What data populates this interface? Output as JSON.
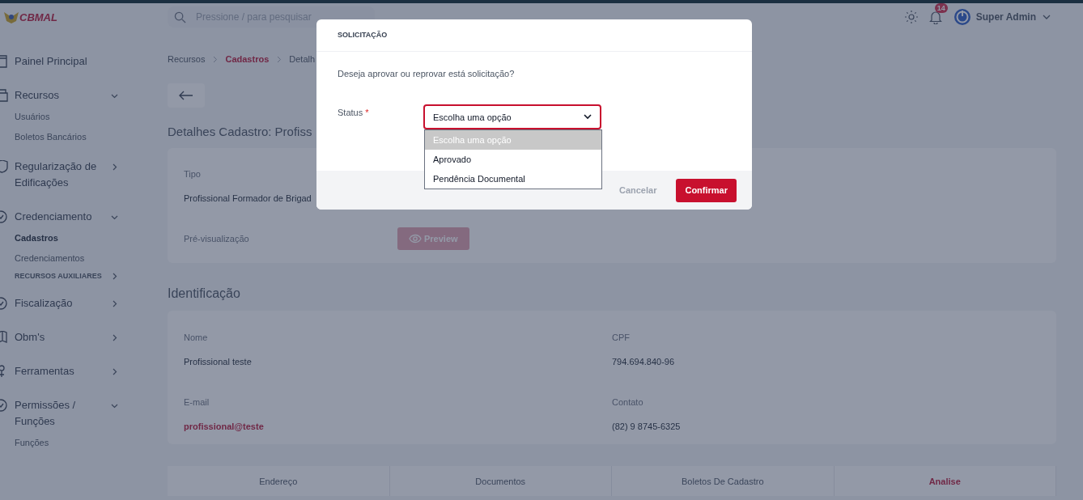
{
  "topbar": {
    "logo": "CBMAL",
    "search": {
      "placeholder": "Pressione / para pesquisar"
    },
    "notifications": "14",
    "user": "Super Admin"
  },
  "sidebar": {
    "items": [
      {
        "label": "Painel Principal",
        "kind": "link"
      },
      {
        "label": "Recursos",
        "kind": "group",
        "expanded": true,
        "children": [
          {
            "label": "Usuários",
            "kind": "link",
            "selected": false
          },
          {
            "label": "Boletos Bancários",
            "kind": "link",
            "selected": false
          }
        ]
      },
      {
        "label": "Regularização de Edificações",
        "kind": "group",
        "expanded": false
      },
      {
        "label": "Credenciamento",
        "kind": "group",
        "expanded": true,
        "children": [
          {
            "label": "Cadastros",
            "kind": "link",
            "selected": true
          },
          {
            "label": "Credenciamentos",
            "kind": "link",
            "selected": false
          },
          {
            "label": "RECURSOS AUXILIARES",
            "kind": "group",
            "selected": false,
            "expanded": false
          }
        ]
      },
      {
        "label": "Fiscalização",
        "kind": "group",
        "expanded": false
      },
      {
        "label": "Obm's",
        "kind": "group",
        "expanded": false
      },
      {
        "label": "Ferramentas",
        "kind": "group",
        "expanded": false
      },
      {
        "label": "Permissões / Funções",
        "kind": "group",
        "expanded": true,
        "children": [
          {
            "label": "Funções",
            "kind": "link",
            "selected": false
          }
        ]
      }
    ]
  },
  "breadcrumb": [
    {
      "label": "Recursos",
      "active": false
    },
    {
      "label": "Cadastros",
      "active": true
    },
    {
      "label": "Detalh",
      "active": false
    }
  ],
  "page": {
    "title": "Detalhes Cadastro: Profiss",
    "details": {
      "type_label": "Tipo",
      "type_value": "Profissional Formador de Brigad",
      "preview_label": "Pré-visualização",
      "preview_button": "Preview"
    },
    "identification": {
      "title": "Identificação",
      "fields": [
        {
          "label": "Nome",
          "value": "Profissional teste",
          "kind": "text"
        },
        {
          "label": "CPF",
          "value": "794.694.840-96",
          "kind": "text"
        },
        {
          "label": "E-mail",
          "value": "profissional@teste",
          "kind": "link"
        },
        {
          "label": "Contato",
          "value": "(82) 9 8745-6325",
          "kind": "text"
        }
      ]
    },
    "tabs": [
      {
        "label": "Endereço",
        "selected": false
      },
      {
        "label": "Documentos",
        "selected": false
      },
      {
        "label": "Boletos De Cadastro",
        "selected": false
      },
      {
        "label": "Analise",
        "selected": true
      }
    ]
  },
  "modal": {
    "title": "SOLICITAÇÃO",
    "question": "Deseja aprovar ou reprovar está solicitação?",
    "field": {
      "label": "Status",
      "required_mark": "*",
      "value": "Escolha uma opção",
      "expanded": true,
      "options": [
        {
          "label": "Escolha uma opção",
          "selected": true
        },
        {
          "label": "Aprovado",
          "selected": false
        },
        {
          "label": "Pendência Documental",
          "selected": false
        }
      ]
    },
    "buttons": {
      "cancel": "Cancelar",
      "confirm": "Confirmar"
    }
  }
}
